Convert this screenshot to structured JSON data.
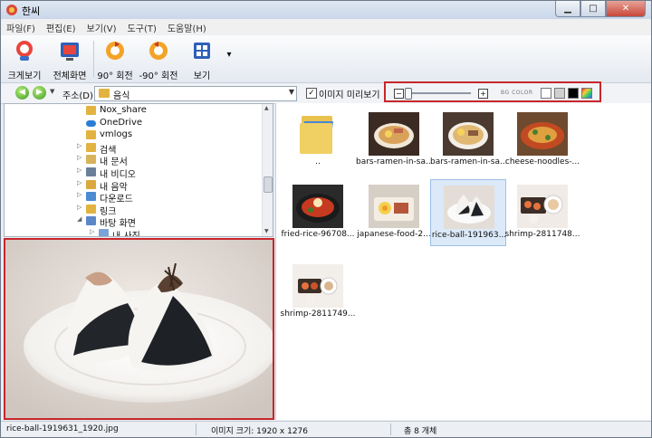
{
  "window": {
    "title": "한씨"
  },
  "menu": [
    "파일(F)",
    "편집(E)",
    "보기(V)",
    "도구(T)",
    "도움말(H)"
  ],
  "toolbar": {
    "large_view": "크게보기",
    "fullscreen": "전체화면",
    "rotate_cw": "90° 회전",
    "rotate_ccw": "-90° 회전",
    "view": "보기",
    "more": "▾"
  },
  "address": {
    "label": "주소(D)",
    "value": "음식"
  },
  "preview_check": {
    "label": "이미지 미리보기",
    "checked": true
  },
  "bg_color": {
    "label": "BG COLOR",
    "swatches": [
      "#ffffff",
      "#d0d0d0",
      "#000000",
      "multicolor"
    ]
  },
  "tree": [
    {
      "label": "Nox_share",
      "indent": 5,
      "icon": "folder-icon",
      "arrow": ""
    },
    {
      "label": "OneDrive",
      "indent": 5,
      "icon": "cloud-icon",
      "arrow": ""
    },
    {
      "label": "vmlogs",
      "indent": 5,
      "icon": "folder-icon",
      "arrow": ""
    },
    {
      "label": "검색",
      "indent": 5,
      "icon": "search-folder-icon",
      "arrow": "▷"
    },
    {
      "label": "내 문서",
      "indent": 5,
      "icon": "documents-icon",
      "arrow": "▷"
    },
    {
      "label": "내 비디오",
      "indent": 5,
      "icon": "videos-icon",
      "arrow": "▷"
    },
    {
      "label": "내 음악",
      "indent": 5,
      "icon": "music-icon",
      "arrow": "▷"
    },
    {
      "label": "다운로드",
      "indent": 5,
      "icon": "downloads-icon",
      "arrow": "▷"
    },
    {
      "label": "링크",
      "indent": 5,
      "icon": "links-icon",
      "arrow": "▷"
    },
    {
      "label": "바탕 화면",
      "indent": 5,
      "icon": "desktop-icon",
      "arrow": "◢"
    },
    {
      "label": "내 사진",
      "indent": 6,
      "icon": "pictures-icon",
      "arrow": "▷"
    }
  ],
  "thumbnails": [
    {
      "label": "..",
      "kind": "folder",
      "selected": false
    },
    {
      "label": "bars-ramen-in-sa...",
      "kind": "ramen",
      "selected": false
    },
    {
      "label": "bars-ramen-in-sa...",
      "kind": "ramen2",
      "selected": false
    },
    {
      "label": "cheese-noodles-...",
      "kind": "noodles",
      "selected": false
    },
    {
      "label": "fried-rice-96708...",
      "kind": "friedrice",
      "selected": false
    },
    {
      "label": "japanese-food-2...",
      "kind": "japanese",
      "selected": false
    },
    {
      "label": "rice-ball-191963...",
      "kind": "riceball",
      "selected": true
    },
    {
      "label": "shrimp-2811748...",
      "kind": "shrimp",
      "selected": false
    },
    {
      "label": "shrimp-2811749...",
      "kind": "shrimp2",
      "selected": false
    }
  ],
  "status": {
    "filename": "rice-ball-1919631_1920.jpg",
    "image_size": "이미지 크기: 1920 x 1276",
    "count": "총 8 개체"
  },
  "colors": {
    "highlight_border": "#c8262b",
    "selection": "#dbe9f8",
    "folder": "#e3b341"
  }
}
